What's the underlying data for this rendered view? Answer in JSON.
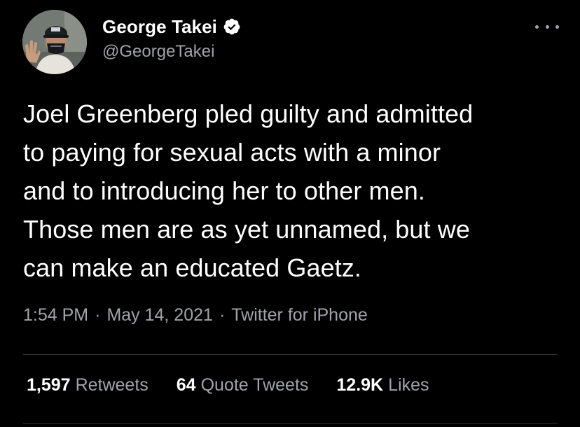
{
  "author": {
    "display_name": "George Takei",
    "handle": "@GeorgeTakei",
    "verified": true,
    "avatar_icon": "profile-photo-masked-man-vulcan-salute"
  },
  "tweet": {
    "text": "Joel Greenberg pled guilty and admitted\nto paying for sexual acts with a minor\nand to introducing her to other men.\nThose men are as yet unnamed, but we\ncan make an educated Gaetz.",
    "time": "1:54 PM",
    "date": "May 14, 2021",
    "source": "Twitter for iPhone",
    "separator": "·"
  },
  "stats": [
    {
      "count": "1,597",
      "label": "Retweets"
    },
    {
      "count": "64",
      "label": "Quote Tweets"
    },
    {
      "count": "12.9K",
      "label": "Likes"
    }
  ],
  "colors": {
    "background": "#000000",
    "primary_text": "#ffffff",
    "secondary_text": "#a0a4a8",
    "divider": "#2f3336",
    "verified_badge": "#ffffff"
  },
  "icons": {
    "more": "more-horizontal-icon",
    "verified": "verified-badge-icon"
  }
}
